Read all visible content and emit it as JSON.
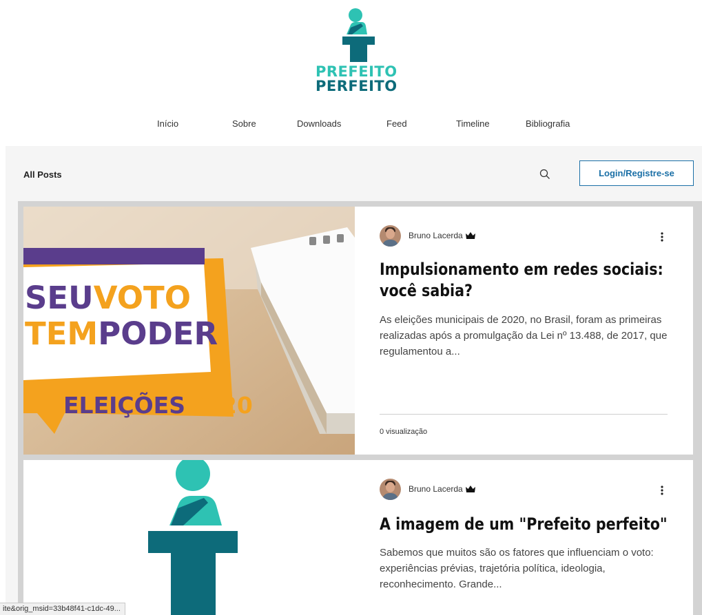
{
  "header": {
    "logo": {
      "line1": "PREFEITO",
      "line2": "PERFEITO",
      "icon": "podium-person-icon"
    }
  },
  "nav": {
    "items": [
      {
        "label": "Início"
      },
      {
        "label": "Sobre"
      },
      {
        "label": "Downloads"
      },
      {
        "label": "Feed"
      },
      {
        "label": "Timeline"
      },
      {
        "label": "Bibliografia"
      }
    ]
  },
  "blog": {
    "all_posts_label": "All Posts",
    "search_icon": "search-icon",
    "login_label": "Login/Registre-se",
    "accent_color": "#1a6fa6",
    "posts": [
      {
        "author": "Bruno Lacerda",
        "author_badge_icon": "crown-icon",
        "title": "Impulsionamento em redes sociais: você sabia?",
        "excerpt": "As eleições municipais de 2020, no Brasil, foram as primeiras realizadas após a promulgação da Lei nº 13.488, de 2017, que regulamentou a...",
        "views": "0 visualização",
        "image": {
          "line1_a": "SEU",
          "line1_b": "VOTO",
          "line2_a": "TEM",
          "line2_b": "PODER",
          "line3_a": "ELEIÇÕES",
          "line3_b": "2020"
        }
      },
      {
        "author": "Bruno Lacerda",
        "author_badge_icon": "crown-icon",
        "title": "A imagem de um \"Prefeito perfeito\"",
        "excerpt": "Sabemos que muitos são os fatores que influenciam o voto: experiências prévias, trajetória política, ideologia, reconhecimento. Grande...",
        "image_icon": "podium-person-icon"
      }
    ]
  },
  "status_bar": {
    "url": "ite&orig_msid=33b48f41-c1dc-49..."
  },
  "colors": {
    "brand_teal": "#2ec2b3",
    "brand_dark_teal": "#0d6b7a",
    "vote_purple": "#5a3d8c",
    "vote_orange": "#f4a21e",
    "vote_red": "#e8485c"
  }
}
